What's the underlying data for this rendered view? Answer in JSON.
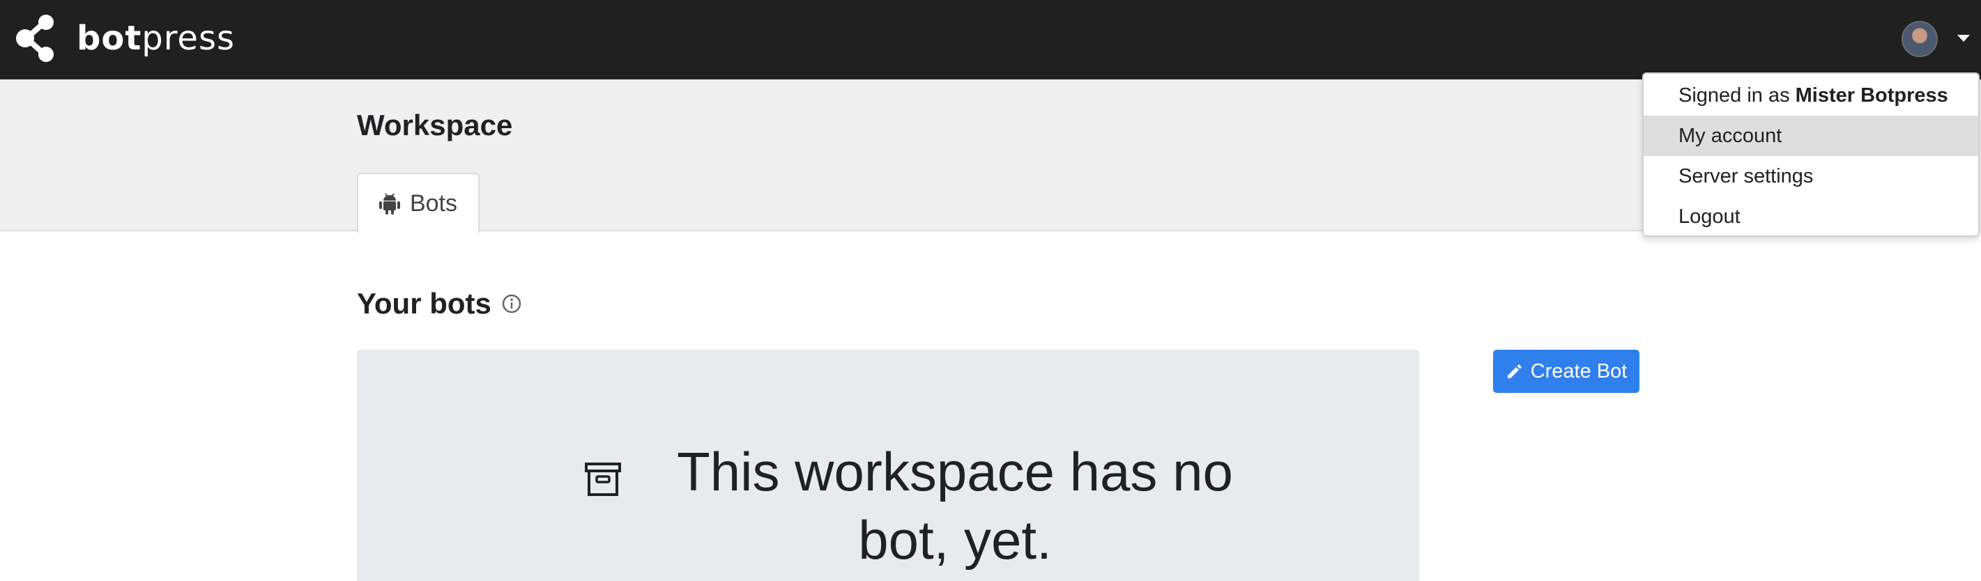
{
  "app": {
    "brand_bold": "bot",
    "brand_rest": "press"
  },
  "header": {
    "page_title": "Workspace",
    "tabs": [
      {
        "label": "Bots",
        "icon": "android-icon"
      }
    ]
  },
  "main": {
    "section_title": "Your bots",
    "empty_state": {
      "line1": "This workspace has no",
      "line2": "bot, yet.",
      "icon": "archive-box-icon"
    },
    "create_button": "Create Bot"
  },
  "user_menu": {
    "signed_in_prefix": "Signed in as",
    "user_name": "Mister Botpress",
    "items": [
      "My account",
      "Server settings",
      "Logout"
    ],
    "active_item": "My account"
  },
  "colors": {
    "topbar": "#202020",
    "accent": "#2f80ed",
    "panel": "#e8ebee"
  }
}
